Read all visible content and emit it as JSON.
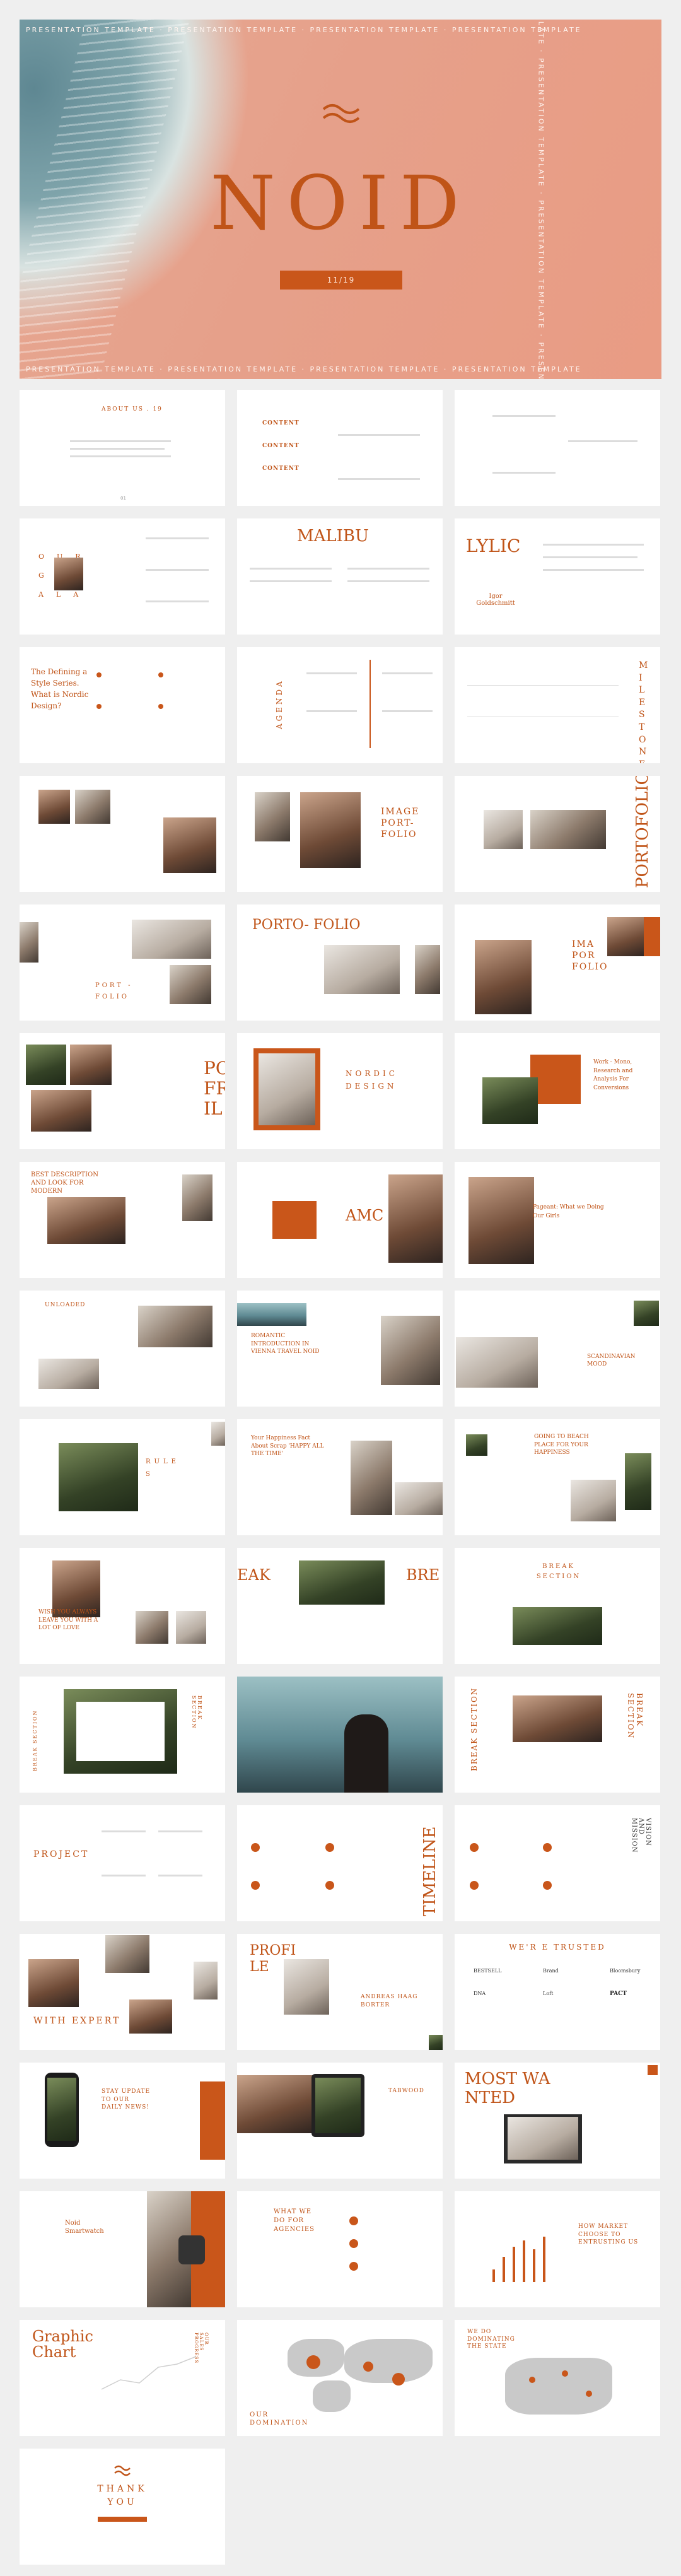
{
  "hero": {
    "band_text": "PRESENTATION TEMPLATE · PRESENTATION TEMPLATE · PRESENTATION TEMPLATE · PRESENTATION TEMPLATE",
    "title": "NOID",
    "date": "11/19"
  },
  "slides": {
    "about": "ABOUT  US . 19",
    "content_1": "CONTENT",
    "content_2": "CONTENT",
    "content_3": "CONTENT",
    "our_goals": "OUR GO ALA",
    "malibu": "MALIBU",
    "lyric": "LYLIC",
    "lyric_author": "Igor Goldschmitt",
    "defining": "The Defining a Style Series. What is Nordic Design?",
    "agenda": "AGENDA",
    "milestone": "M I L E S T O N E",
    "image_portfolio": "IMAGE PORT- FOLIO",
    "portofolio_vertical": "PORTOFOLIO",
    "port_folio": "PORT - FOLIO",
    "portfolio_2": "PORTO- FOLIO",
    "ima_port": "IMA POR FOLIO",
    "po_fr_il": "PO FR IL",
    "nordic_design": "NORDIC DESIGN",
    "work": "Work - Mono, Research and Analysis For Conversions",
    "best": "BEST DESCRIPTION AND LOOK FOR MODERN",
    "amc": "AMC",
    "fagency": "Pageant: What we Doing Our Girls",
    "unloaded": "UNLOADED",
    "romantic": "ROMANTIC INTRODUCTION IN VIENNA TRAVEL NOID",
    "scandinavian": "SCANDINAVIAN MOOD",
    "your_happiness": "Your Happiness Fact About Scrap 'HAPPY ALL THE TIME'",
    "going_to": "GOING TO BEACH PLACE FOR YOUR HAPPINESS",
    "wish": "WISH YOU ALWAYS LEAVE YOU WITH A LOT OF LOVE",
    "break_eak": "EAK",
    "break_bre": "BRE",
    "break_section": "BREAK SECTION",
    "break_vertical": "BREAK SECTION",
    "project": "PROJECT",
    "timeline": "TIMELINE",
    "vision": "VISION AND MISSION",
    "with_expert": "WITH EXPERT",
    "profile": "PROFI LE",
    "andreas": "ANDREAS HAAG BORTER",
    "trusted": "WE'R E TRUSTED",
    "logos": [
      "BESTSELL",
      "Brand",
      "Bloomsbury",
      "PACT",
      "DNA",
      "Loft"
    ],
    "stay": "STAY UPDATE TO OUR DAILY NEWS!",
    "tabwood": "TABWOOD",
    "most_wanted": "MOST WA NTED",
    "smartwatch": "Noid Smartwatch",
    "what_we_do": "WHAT WE DO FOR AGENCIES",
    "how_market": "HOW MARKET CHOOSE TO ENTRUSTING US",
    "graphic_chart": "Graphic Chart",
    "our_domination": "OUR DOMINATION",
    "we_do": "WE DO DOMINATING THE STATE",
    "thank_you": "THANK YOU"
  }
}
